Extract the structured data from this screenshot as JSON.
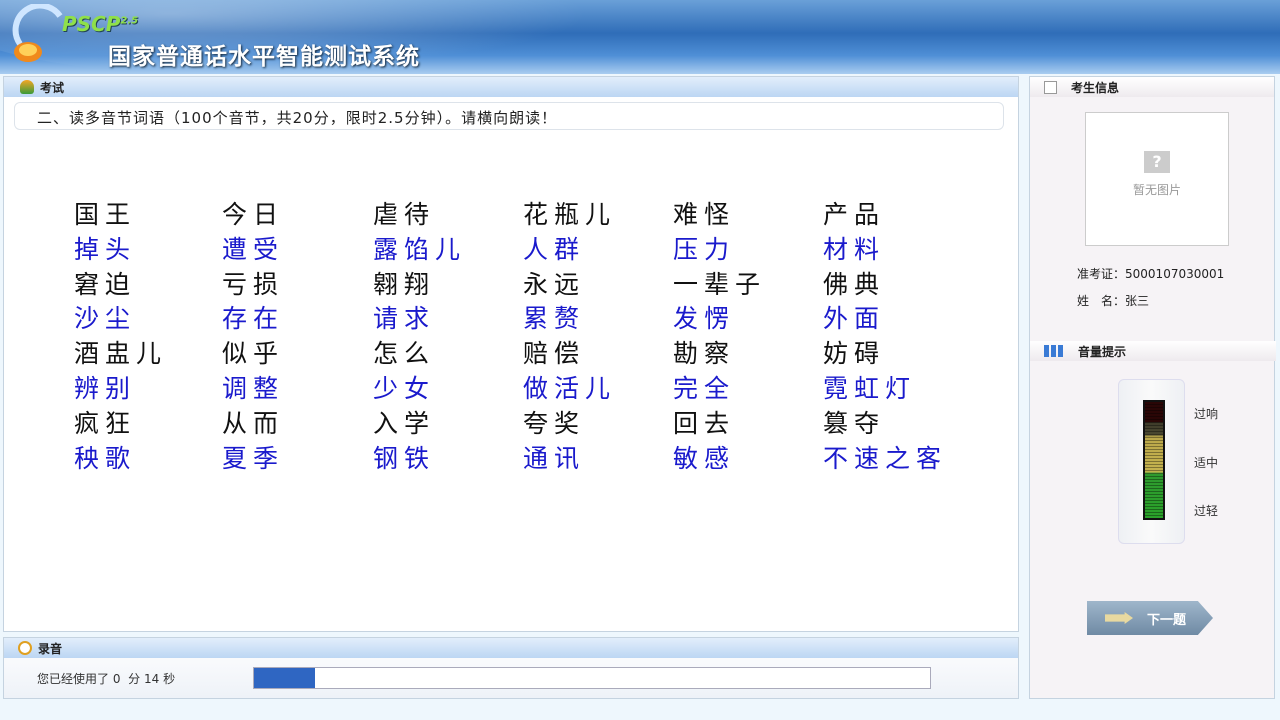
{
  "header": {
    "brand": "PSCP",
    "version": "2.5",
    "title": "国家普通话水平智能测试系统"
  },
  "exam": {
    "panel_title": "考试",
    "instruction": "二、读多音节词语（100个音节，共20分，限时2.5分钟）。请横向朗读！",
    "colors": {
      "odd_row": "#111111",
      "even_row": "#1a1acc"
    },
    "rows": [
      [
        "国王",
        "今日",
        "虐待",
        "花瓶儿",
        "难怪",
        "产品"
      ],
      [
        "掉头",
        "遭受",
        "露馅儿",
        "人群",
        "压力",
        "材料"
      ],
      [
        "窘迫",
        "亏损",
        "翱翔",
        "永远",
        "一辈子",
        "佛典"
      ],
      [
        "沙尘",
        "存在",
        "请求",
        "累赘",
        "发愣",
        "外面"
      ],
      [
        "酒盅儿",
        "似乎",
        "怎么",
        "赔偿",
        "勘察",
        "妨碍"
      ],
      [
        "辨别",
        "调整",
        "少女",
        "做活儿",
        "完全",
        "霓虹灯"
      ],
      [
        "疯狂",
        "从而",
        "入学",
        "夸奖",
        "回去",
        "篡夺"
      ],
      [
        "秧歌",
        "夏季",
        "钢铁",
        "通讯",
        "敏感",
        "不速之客"
      ]
    ]
  },
  "recording": {
    "panel_title": "录音",
    "elapsed_prefix": "您已经使用了",
    "minutes": "0",
    "minutes_unit": "分",
    "seconds": "14",
    "seconds_unit": "秒",
    "progress_percent": 9,
    "progress_color": "#2f66c2"
  },
  "candidate": {
    "panel_title": "考生信息",
    "photo_placeholder": "暂无图片",
    "id_label": "准考证：",
    "id_value": "5000107030001",
    "name_label": "姓　名：",
    "name_value": "张三"
  },
  "volume": {
    "panel_title": "音量提示",
    "labels": [
      "过响",
      "适中",
      "过轻"
    ]
  },
  "next_button": {
    "label": "下一题"
  }
}
